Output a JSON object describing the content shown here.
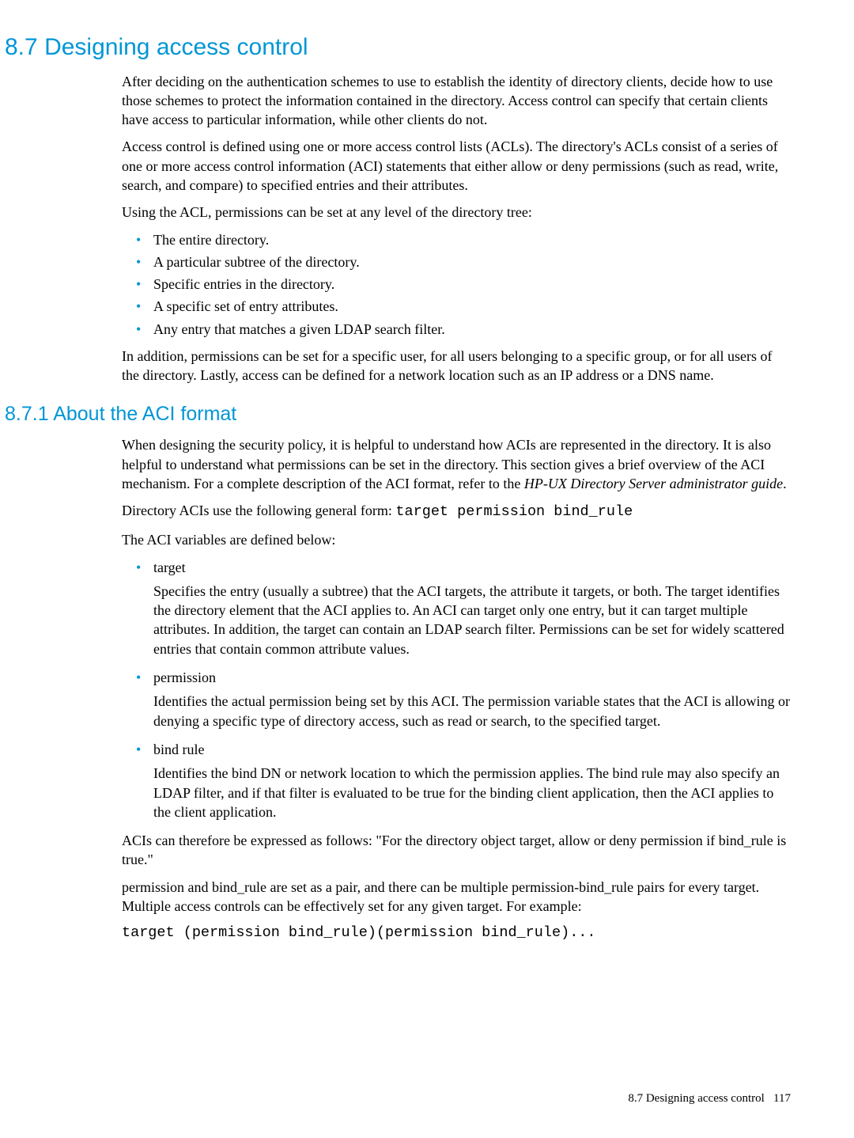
{
  "section": {
    "number": "8.7",
    "title": "Designing access control"
  },
  "p1": "After deciding on the authentication schemes to use to establish the identity of directory clients, decide how to use those schemes to protect the information contained in the directory. Access control can specify that certain clients have access to particular information, while other clients do not.",
  "p2": "Access control is defined using one or more access control lists (ACLs). The directory's ACLs consist of a series of one or more access control information (ACI) statements that either allow or deny permissions (such as read, write, search, and compare) to specified entries and their attributes.",
  "p3": "Using the ACL, permissions can be set at any level of the directory tree:",
  "list1": [
    "The entire directory.",
    "A particular subtree of the directory.",
    "Specific entries in the directory.",
    "A specific set of entry attributes.",
    "Any entry that matches a given LDAP search filter."
  ],
  "p4": "In addition, permissions can be set for a specific user, for all users belonging to a specific group, or for all users of the directory. Lastly, access can be defined for a network location such as an IP address or a DNS name.",
  "subsection": {
    "number": "8.7.1",
    "title": "About the ACI format"
  },
  "p5_a": "When designing the security policy, it is helpful to understand how ACIs are represented in the directory. It is also helpful to understand what permissions can be set in the directory. This section gives a brief overview of the ACI mechanism. For a complete description of the ACI format, refer to the ",
  "p5_em": "HP-UX Directory Server administrator guide",
  "p5_b": ".",
  "p6_a": "Directory ACIs use the following general form: ",
  "p6_code": "target permission bind_rule",
  "p7": "The ACI variables are defined below:",
  "defs": [
    {
      "term": "target",
      "body": "Specifies the entry (usually a subtree) that the ACI targets, the attribute it targets, or both. The target identifies the directory element that the ACI applies to. An ACI can target only one entry, but it can target multiple attributes. In addition, the target can contain an LDAP search filter. Permissions can be set for widely scattered entries that contain common attribute values."
    },
    {
      "term": "permission",
      "body": "Identifies the actual permission being set by this ACI. The permission variable states that the ACI is allowing or denying a specific type of directory access, such as read or search, to the specified target."
    },
    {
      "term": "bind rule",
      "body": "Identifies the bind DN or network location to which the permission applies. The bind rule may also specify an LDAP filter, and if that filter is evaluated to be true for the binding client application, then the ACI applies to the client application."
    }
  ],
  "p8": "ACIs can therefore be expressed as follows: \"For the directory object target, allow or deny permission if bind_rule is true.\"",
  "p9": "permission and bind_rule are set as a pair, and there can be multiple permission-bind_rule pairs for every target. Multiple access controls can be effectively set for any given target. For example:",
  "code_example": "target (permission bind_rule)(permission bind_rule)...",
  "footer": {
    "label": "8.7 Designing access control",
    "page": "117"
  }
}
